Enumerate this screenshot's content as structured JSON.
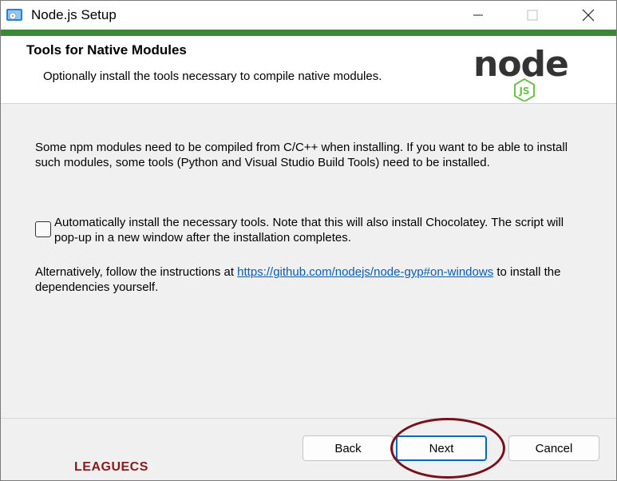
{
  "window": {
    "title": "Node.js Setup"
  },
  "header": {
    "title": "Tools for Native Modules",
    "subtitle": "Optionally install the tools necessary to compile native modules."
  },
  "logo": {
    "word": "node",
    "badge": "JS",
    "colors": {
      "dark": "#333333",
      "green": "#6cc24a"
    }
  },
  "body": {
    "description": "Some npm modules need to be compiled from C/C++ when installing. If you want to be able to install such modules, some tools (Python and Visual Studio Build Tools) need to be installed.",
    "checkbox": {
      "checked": false,
      "label": "Automatically install the necessary tools. Note that this will also install Chocolatey. The script will pop-up in a new window after the installation completes."
    },
    "alternative": {
      "prefix": "Alternatively, follow the instructions at ",
      "link": "https://github.com/nodejs/node-gyp#on-windows",
      "suffix": " to install the dependencies yourself."
    }
  },
  "buttons": {
    "back": "Back",
    "next": "Next",
    "cancel": "Cancel"
  },
  "watermark": "LEAGUECS",
  "colors": {
    "accent": "#3c873a",
    "link": "#0b5cad",
    "highlight": "#7a0f1c"
  }
}
